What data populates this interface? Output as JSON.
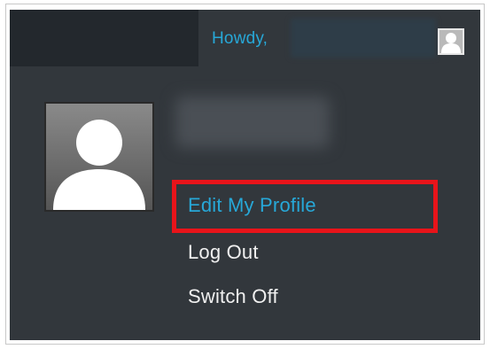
{
  "toolbar": {
    "greeting": "Howdy,",
    "username_blurred": true,
    "avatar_icon": "user-silhouette-icon",
    "link_color": "#27a8d8",
    "bar_color": "#32373c",
    "bar_left_color": "#23282d"
  },
  "profile_menu": {
    "avatar_icon": "user-silhouette-icon",
    "display_name_blurred": true,
    "items": [
      {
        "label": "Edit My Profile",
        "highlighted": true
      },
      {
        "label": "Log Out",
        "highlighted": false
      },
      {
        "label": "Switch Off",
        "highlighted": false
      }
    ],
    "highlight_color": "#e8141a"
  }
}
